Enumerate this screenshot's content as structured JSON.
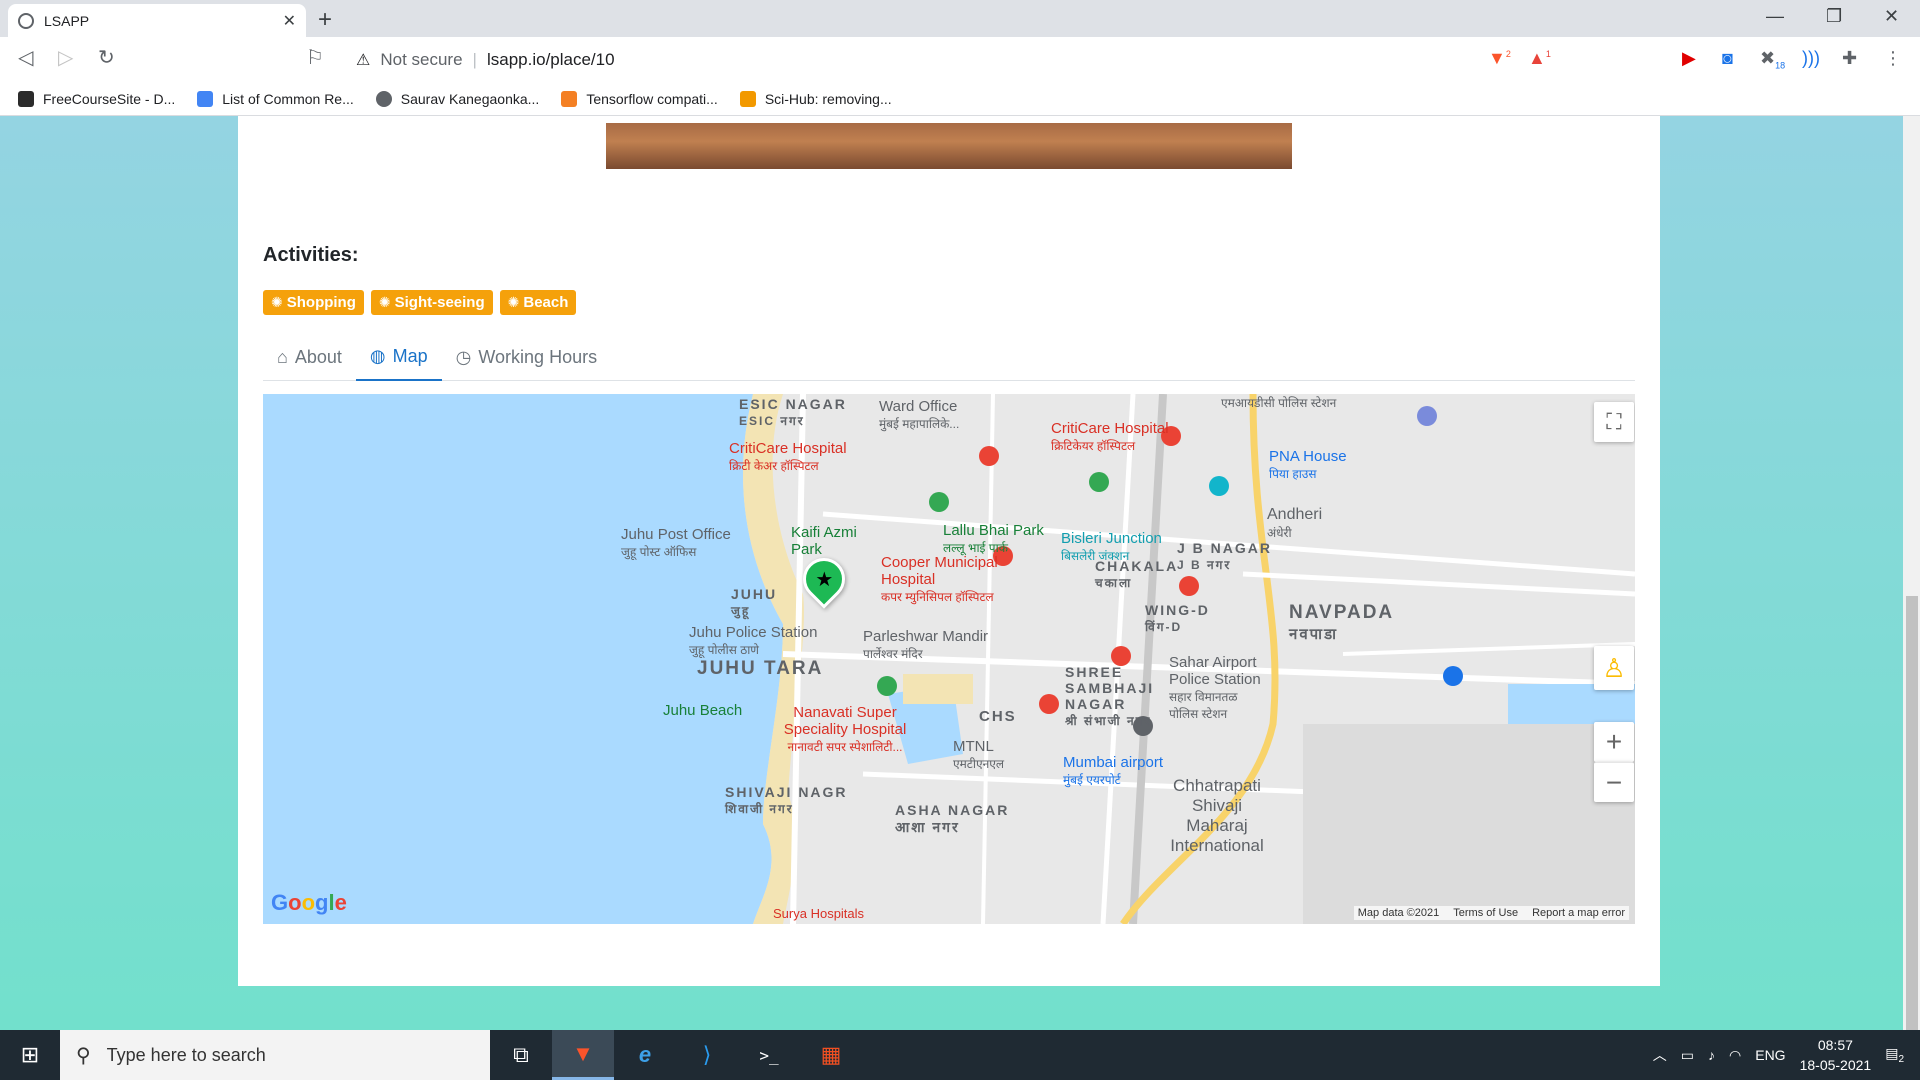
{
  "browser": {
    "tab_title": "LSAPP",
    "not_secure": "Not secure",
    "url": "lsapp.io/place/10",
    "bookmarks": [
      {
        "label": "FreeCourseSite - D...",
        "color": "#2b2b2b"
      },
      {
        "label": "List of Common Re...",
        "color": "#4285f4"
      },
      {
        "label": "Saurav Kanegaonka...",
        "color": "#5f6368"
      },
      {
        "label": "Tensorflow compati...",
        "color": "#f48024"
      },
      {
        "label": "Sci-Hub: removing...",
        "color": "#f29900"
      }
    ],
    "ext_badges": {
      "brave": "2",
      "alert": "1",
      "ext": "18"
    }
  },
  "page": {
    "activities_heading": "Activities:",
    "badges": [
      "Shopping",
      "Sight-seeing",
      "Beach"
    ],
    "tabs": [
      {
        "label": "About",
        "icon": "home-icon"
      },
      {
        "label": "Map",
        "icon": "globe-icon"
      },
      {
        "label": "Working Hours",
        "icon": "clock-icon"
      }
    ],
    "active_tab": "Map"
  },
  "map": {
    "labels": {
      "esic": "ESIC NAGAR",
      "esic_sub": "ESIC नगर",
      "ward": "Ward Office",
      "ward_sub": "मुंबई महापालिके...",
      "criticare1": "CritiCare Hospital",
      "criticare1_sub": "क्रिटी केअर हॉस्पिटल",
      "criticare2": "CritiCare Hospital",
      "criticare2_sub": "क्रिटिकेयर हॉस्पिटल",
      "police_top": "एमआयडीसी पोलिस स्टेशन",
      "pna": "PNA House",
      "pna_sub": "पिया हाउस",
      "andheri": "Andheri",
      "andheri_sub": "अंधेरी",
      "juhu_po": "Juhu Post Office",
      "juhu_po_sub": "जुहू पोस्ट ऑफिस",
      "kaifi": "Kaifi Azmi Park",
      "lallu": "Lallu Bhai Park",
      "lallu_sub": "लल्लू भाई पार्क",
      "bisleri": "Bisleri Junction",
      "bisleri_sub": "बिसलेरी जंक्शन",
      "chakala": "CHAKALA",
      "chakala_sub": "चकाला",
      "jbnagar": "J B NAGAR",
      "jbnagar_sub": "J B नगर",
      "cooper": "Cooper Municipal Hospital",
      "cooper_sub": "कपर म्युनिसिपल हॉस्पिटल",
      "juhu": "JUHU",
      "juhu_sub": "जुहू",
      "wingd": "WING-D",
      "wingd_sub": "विंग-D",
      "navpada": "NAVPADA",
      "navpada_sub": "नवपाडा",
      "juhu_ps": "Juhu Police Station",
      "juhu_ps_sub": "जुहू पोलीस ठाणे",
      "parleshwar": "Parleshwar Mandir",
      "parleshwar_sub": "पार्लेश्वर मंदिर",
      "juhutara": "JUHU TARA",
      "shree": "SHREE SAMBHAJI NAGAR",
      "shree_sub": "श्री संभाजी नगर",
      "sahar": "Sahar Airport Police Station",
      "sahar_sub": "सहार विमानतळ पोलिस स्टेशन",
      "juhubeach": "Juhu Beach",
      "nanavati": "Nanavati Super Speciality Hospital",
      "nanavati_sub": "नानावटी सपर स्पेशालिटी...",
      "chs": "CHS",
      "mtnl": "MTNL",
      "mtnl_sub": "एमटीएनएल",
      "mumbai_airport": "Mumbai airport",
      "mumbai_airport_sub": "मुंबई एयरपोर्ट",
      "shivaji": "SHIVAJI NAGR",
      "shivaji_sub": "शिवाजी नगर",
      "chhatrapati": "Chhatrapati Shivaji Maharaj International",
      "ashanagar": "ASHA NAGAR",
      "ashanagar_sub": "आशा नगर",
      "surya": "Surya Hospitals"
    },
    "zoom_in": "+",
    "zoom_out": "−",
    "google": "Google",
    "footer": [
      "Map data ©2021",
      "Terms of Use",
      "Report a map error"
    ],
    "colors": {
      "water": "#aadaff",
      "land": "#e8e8e8",
      "highway": "#f8d36a",
      "park": "#c5e8c5",
      "marker": "#1db954"
    }
  },
  "taskbar": {
    "search_placeholder": "Type here to search",
    "lang": "ENG",
    "time": "08:57",
    "date": "18-05-2021",
    "notif_count": "2"
  }
}
